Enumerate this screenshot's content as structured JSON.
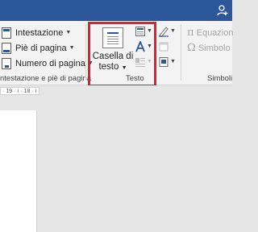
{
  "ribbon": {
    "header_footer_group": {
      "buttons": [
        {
          "label": "Intestazione",
          "icon": "header-icon"
        },
        {
          "label": "Piè di pagina",
          "icon": "footer-icon"
        },
        {
          "label": "Numero di pagina",
          "icon": "page-number-icon"
        }
      ],
      "group_label": "ntestazione e piè di pagina"
    },
    "text_group": {
      "textbox_label_line1": "Casella di",
      "textbox_label_line2": "testo",
      "group_label": "Testo"
    },
    "symbols_group": {
      "equation_label": "Equazion",
      "symbol_label": "Simbolo",
      "group_label": "Simboli"
    }
  },
  "ruler": {
    "text": "· 19 · ı · 18 · ı ·"
  },
  "colors": {
    "accent": "#2b579a",
    "highlight": "#e0202a",
    "ribbon_bg": "#f3f3f3",
    "canvas_bg": "#e6e6e6"
  }
}
